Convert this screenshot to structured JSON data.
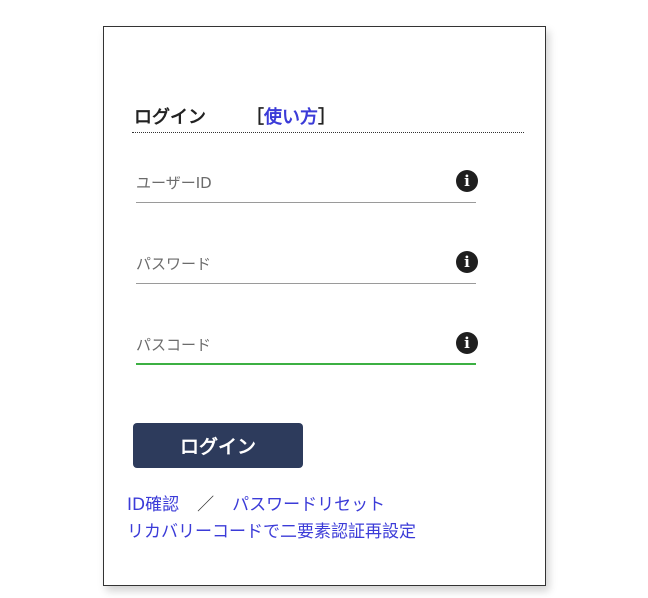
{
  "header": {
    "title": "ログイン",
    "howto_open": "［",
    "howto_label": "使い方",
    "howto_close": "］"
  },
  "form": {
    "user_id_placeholder": "ユーザーID",
    "password_placeholder": "パスワード",
    "passcode_placeholder": "パスコード",
    "info_glyph": "i",
    "login_label": "ログイン"
  },
  "links": {
    "id_confirm": "ID確認",
    "separator": "／",
    "password_reset": "パスワードリセット",
    "recovery": "リカバリーコードで二要素認証再設定"
  },
  "colors": {
    "link": "#3b3bd8",
    "button": "#2d3b5c",
    "active_underline": "#3cb043"
  },
  "icons": [
    "info-icon"
  ]
}
